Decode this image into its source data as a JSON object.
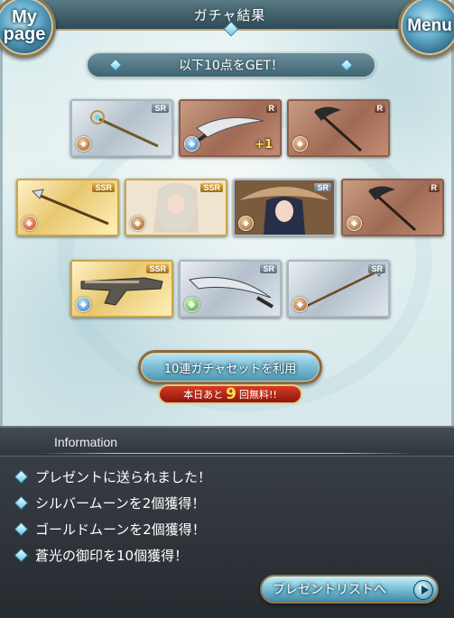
{
  "header": {
    "title": "ガチャ結果",
    "mypage_label": "My page",
    "menu_label": "Menu"
  },
  "banner": {
    "text": "以下10点をGET！"
  },
  "cards": [
    {
      "rarity": "SR",
      "element": "earth",
      "item": "staff"
    },
    {
      "rarity": "R",
      "element": "water",
      "item": "sword",
      "bonus": "+1"
    },
    {
      "rarity": "R",
      "element": "earth",
      "item": "axe"
    },
    {
      "rarity": "SSR",
      "element": "fire",
      "item": "spear"
    },
    {
      "rarity": "SSR",
      "element": "earth",
      "item": "character"
    },
    {
      "rarity": "SR",
      "element": "earth",
      "item": "character"
    },
    {
      "rarity": "R",
      "element": "earth",
      "item": "axe"
    },
    {
      "rarity": "SSR",
      "element": "water",
      "item": "gun"
    },
    {
      "rarity": "SR",
      "element": "wind",
      "item": "sword"
    },
    {
      "rarity": "SR",
      "element": "earth",
      "item": "spear"
    }
  ],
  "gacha_button": {
    "label": "10連ガチャセットを利用",
    "free_prefix": "本日あと",
    "free_count": "9",
    "free_suffix": "回無料!!"
  },
  "info": {
    "title": "Information",
    "items": [
      "プレゼントに送られました！",
      "シルバームーンを2個獲得！",
      "ゴールドムーンを2個獲得！",
      "蒼光の御印を10個獲得！"
    ],
    "present_button": "プレゼントリストへ"
  },
  "colors": {
    "accent_gold": "#c9a64a",
    "free_badge_red": "#d83b26",
    "highlight_yellow": "#ffe04a"
  }
}
